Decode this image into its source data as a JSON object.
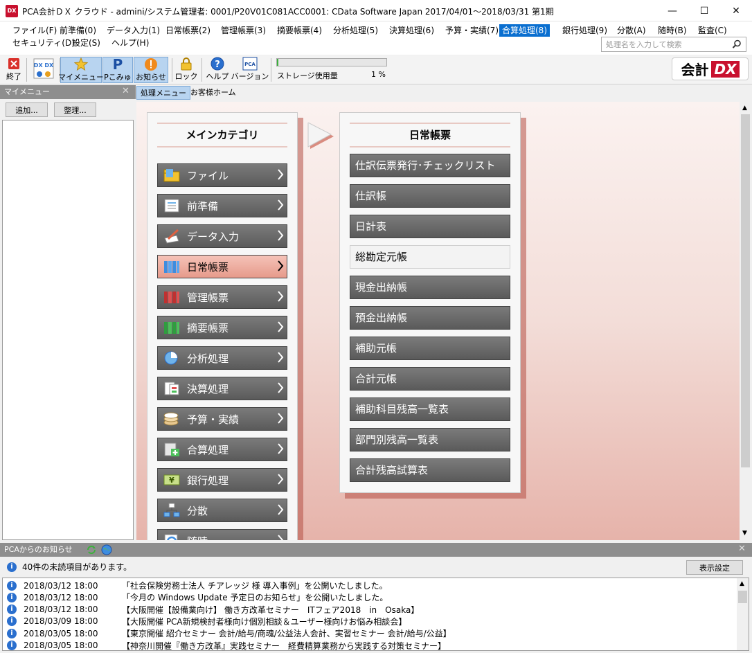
{
  "window": {
    "title": "PCA会計ＤＸ クラウド - admini/システム管理者: 0001/P20V01C081ACC0001: CData Software Japan 2017/04/01～2018/03/31 第1期",
    "minimize": "—",
    "maximize": "☐",
    "close": "✕"
  },
  "menu": {
    "row1": [
      "ファイル(F)",
      "前準備(0)",
      "データ入力(1)",
      "日常帳票(2)",
      "管理帳票(3)",
      "摘要帳票(4)",
      "分析処理(5)",
      "決算処理(6)",
      "予算・実績(7)",
      "合算処理(8)",
      "銀行処理(9)",
      "分散(A)",
      "随時(B)",
      "監査(C)"
    ],
    "row2": [
      "セキュリティ(D)",
      "設定(S)",
      "ヘルプ(H)"
    ],
    "active_index": 9,
    "search_placeholder": "処理名を入力して検索"
  },
  "toolbar": {
    "exit": "終了",
    "mymenu": "マイメニュー",
    "pcomyu": "Pこみゅ",
    "notice": "お知らせ",
    "lock": "ロック",
    "help": "ヘルプ",
    "version": "バージョン",
    "storage_label": "ストレージ使用量",
    "storage_pct": "1 %",
    "storage_value": 1,
    "logo_text": "会計",
    "logo_dx": "DX"
  },
  "left_pane": {
    "title": "マイメニュー",
    "add": "追加...",
    "organize": "整理..."
  },
  "tabs": [
    "処理メニュー",
    "お客様ホーム"
  ],
  "main_category": {
    "title": "メインカテゴリ",
    "items": [
      {
        "label": "ファイル",
        "icon": "folder-icon"
      },
      {
        "label": "前準備",
        "icon": "preparation-icon"
      },
      {
        "label": "データ入力",
        "icon": "data-entry-icon"
      },
      {
        "label": "日常帳票",
        "icon": "daily-ledger-icon",
        "selected": true
      },
      {
        "label": "管理帳票",
        "icon": "management-ledger-icon"
      },
      {
        "label": "摘要帳票",
        "icon": "summary-ledger-icon"
      },
      {
        "label": "分析処理",
        "icon": "analysis-icon"
      },
      {
        "label": "決算処理",
        "icon": "settlement-icon"
      },
      {
        "label": "予算・実績",
        "icon": "budget-icon"
      },
      {
        "label": "合算処理",
        "icon": "consolidation-icon"
      },
      {
        "label": "銀行処理",
        "icon": "bank-icon"
      },
      {
        "label": "分散",
        "icon": "distribution-icon"
      },
      {
        "label": "随時",
        "icon": "anytime-icon"
      }
    ]
  },
  "sub_category": {
    "title": "日常帳票",
    "items": [
      {
        "label": "仕訳伝票発行･チェックリスト"
      },
      {
        "label": "仕訳帳"
      },
      {
        "label": "日計表"
      },
      {
        "label": "総勘定元帳",
        "light": true
      },
      {
        "label": "現金出納帳"
      },
      {
        "label": "預金出納帳"
      },
      {
        "label": "補助元帳"
      },
      {
        "label": "合計元帳"
      },
      {
        "label": "補助科目残高一覧表"
      },
      {
        "label": "部門別残高一覧表"
      },
      {
        "label": "合計残高試算表"
      }
    ]
  },
  "notices": {
    "title": "PCAからのお知らせ",
    "summary": "40件の未読項目があります。",
    "display_settings": "表示設定",
    "items": [
      {
        "date": "2018/03/12 18:00",
        "title": "「社会保険労務士法人 チアレッジ 様 導入事例」を公開いたしました。"
      },
      {
        "date": "2018/03/12 18:00",
        "title": "「今月の Windows Update 予定日のお知らせ」を公開いたしました。"
      },
      {
        "date": "2018/03/12 18:00",
        "title": "【大阪開催【設備業向け】 働き方改革セミナー　ITフェア2018　in　Osaka】"
      },
      {
        "date": "2018/03/09 18:00",
        "title": "【大阪開催 PCA新規検討者様向け個別相談＆ユーザー様向けお悩み相談会】"
      },
      {
        "date": "2018/03/05 18:00",
        "title": "【東京開催 紹介セミナー 会計/給与/商魂/公益法人会計、実習セミナー 会計/給与/公益】"
      },
      {
        "date": "2018/03/05 18:00",
        "title": "【神奈川開催『働き方改革』実践セミナー　経費精算業務から実践する対策セミナー】"
      }
    ]
  }
}
